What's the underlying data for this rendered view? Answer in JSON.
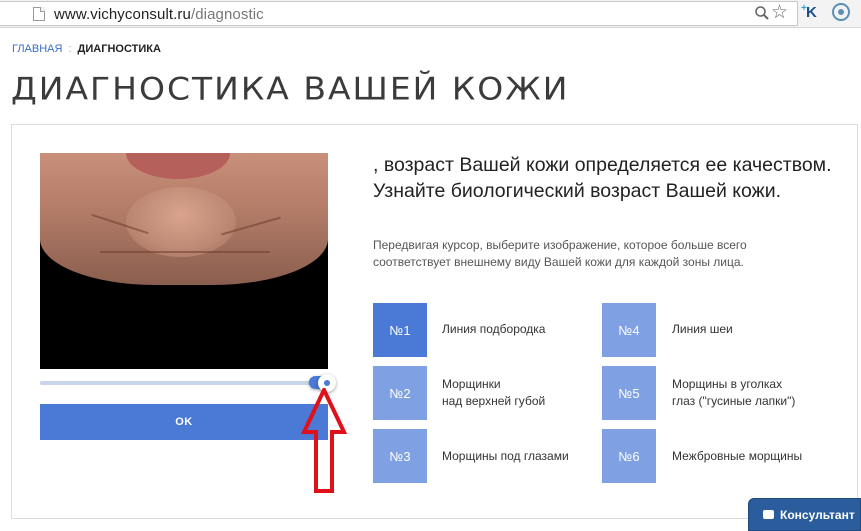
{
  "browser": {
    "url_domain": "www.vichyconsult.ru",
    "url_path": "/diagnostic",
    "icons": [
      "page-icon",
      "zoom-icon",
      "star-icon",
      "extension-k-icon",
      "extension-round-icon"
    ]
  },
  "breadcrumb": {
    "home": "ГЛАВНАЯ",
    "separator": ":",
    "current": "ДИАГНОСТИКА"
  },
  "page": {
    "title": "ДИАГНОСТИКА ВАШЕЙ КОЖИ"
  },
  "diagnostic": {
    "headline": ", возраст Вашей кожи определяется ее качеством. Узнайте биологический возраст Вашей кожи.",
    "instructions": "Передвигая курсор, выберите изображение, которое больше всего соответствует внешнему виду Вашей кожи для каждой зоны лица.",
    "ok_label": "OK",
    "slider_value_fraction": 0.97,
    "zones": [
      {
        "num": "№1",
        "label": "Линия подбородка",
        "active": true
      },
      {
        "num": "№2",
        "label_line1": "Морщинки",
        "label_line2": "над верхней губой",
        "active": false
      },
      {
        "num": "№3",
        "label": "Морщины под глазами",
        "active": false
      },
      {
        "num": "№4",
        "label": "Линия шеи",
        "active": false
      },
      {
        "num": "№5",
        "label_line1": "Морщины в уголках",
        "label_line2": "глаз (\"гусиные лапки\")",
        "active": false
      },
      {
        "num": "№6",
        "label": "Межбровные морщины",
        "active": false
      }
    ]
  },
  "consultant": {
    "label": "Консультант"
  },
  "colors": {
    "accent": "#4a7ad6",
    "tile_inactive": "#7fa0e2",
    "arrow": "#e0101a",
    "consult": "#2b5d9c"
  }
}
